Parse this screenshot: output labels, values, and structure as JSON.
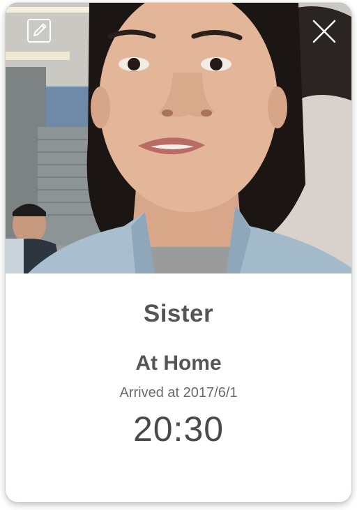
{
  "card": {
    "name": "Sister",
    "location": "At Home",
    "arrived_text": "Arrived at 2017/6/1",
    "time": "20:30"
  },
  "icons": {
    "edit": "edit-pencil-icon",
    "close": "close-icon"
  },
  "colors": {
    "text_primary": "#555555",
    "text_secondary": "#6a6a6a",
    "card_background": "#ffffff"
  }
}
